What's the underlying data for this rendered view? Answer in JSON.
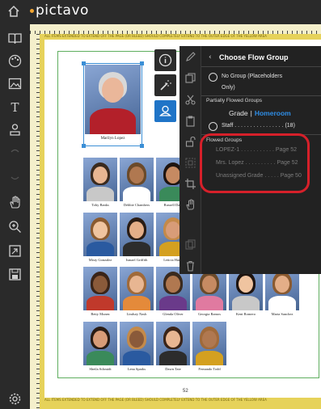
{
  "app": {
    "name": "pictavo"
  },
  "rulers": {
    "bleed_text_top": "ALL ITEMS EXTENDED TO EXTEND OFF THE PAGE (OR BLEED) SHOULD COMPLETELY EXTEND TO THE OUTER EDGE OF THE YELLOW AREA",
    "bleed_text_bottom": "ALL ITEMS EXTENDED TO EXTEND OFF THE PAGE (OR BLEED) SHOULD COMPLETELY EXTEND TO THE OUTER EDGE OF THE YELLOW AREA"
  },
  "page": {
    "number": "52",
    "teacher": {
      "name": "Marilyn Lopez"
    },
    "students": [
      {
        "name": "Toby Banks",
        "row": 1
      },
      {
        "name": "Debbie Chambers",
        "row": 1
      },
      {
        "name": "Russell Daw",
        "row": 1
      },
      {
        "name": "Misty Gonzalez",
        "row": 2
      },
      {
        "name": "Ismael Griffith",
        "row": 2
      },
      {
        "name": "Leticia Hami",
        "row": 2
      },
      {
        "name": "Betty Munez",
        "row": 3
      },
      {
        "name": "Lindsey Nash",
        "row": 3
      },
      {
        "name": "Glenda Oliver",
        "row": 3
      },
      {
        "name": "Georgia Ramos",
        "row": 3
      },
      {
        "name": "Kent Romero",
        "row": 3
      },
      {
        "name": "Marta Sanchez",
        "row": 3
      },
      {
        "name": "Sheila Schmidt",
        "row": 4
      },
      {
        "name": "Lena Sparks",
        "row": 4
      },
      {
        "name": "Dawn Tate",
        "row": 4
      },
      {
        "name": "Fernando Todd",
        "row": 4
      }
    ]
  },
  "flow_panel": {
    "title": "Choose Flow Group",
    "no_group_line1": "No Group (Placeholders",
    "no_group_line2": "Only)",
    "partially_flowed_label": "Partially Flowed Groups",
    "toggle_grade": "Grade",
    "toggle_separator": "|",
    "toggle_homeroom": "Homeroom",
    "staff_label": "Staff . . . . . . . . . . . . . . . . (18)",
    "flowed_label": "Flowed Groups",
    "flowed_groups": [
      {
        "label": "LOPEZ-1 . . . . . . . . . . . Page 52"
      },
      {
        "label": "Mrs. Lopez . . . . . . . . . . Page 52"
      },
      {
        "label": "Unassigned Grade . . . . . Page 50"
      }
    ]
  },
  "colors": {
    "accent_blue": "#1f74c7",
    "homeroom_blue": "#2f8fe8",
    "annotation_red": "#d6202a",
    "bleed_yellow": "#e6d25a",
    "guide_green": "#5fae5f"
  },
  "icons": {
    "topbar": [
      "home-icon"
    ],
    "left_toolbar": [
      "book-icon",
      "palette-icon",
      "image-icon",
      "text-icon",
      "stamp-icon",
      "undo-icon",
      "redo-icon",
      "hand-icon",
      "zoom-icon",
      "page-export-icon",
      "save-icon",
      "settings-gear-icon"
    ],
    "floating": [
      "info-icon",
      "magic-wand-icon",
      "portrait-flow-icon"
    ],
    "panel_tools": [
      "pencil-icon",
      "copy-icon",
      "cut-icon",
      "paste-icon",
      "unlock-icon",
      "group-icon",
      "crop-icon",
      "pan-icon",
      "duplicate-icon",
      "trash-icon"
    ]
  }
}
